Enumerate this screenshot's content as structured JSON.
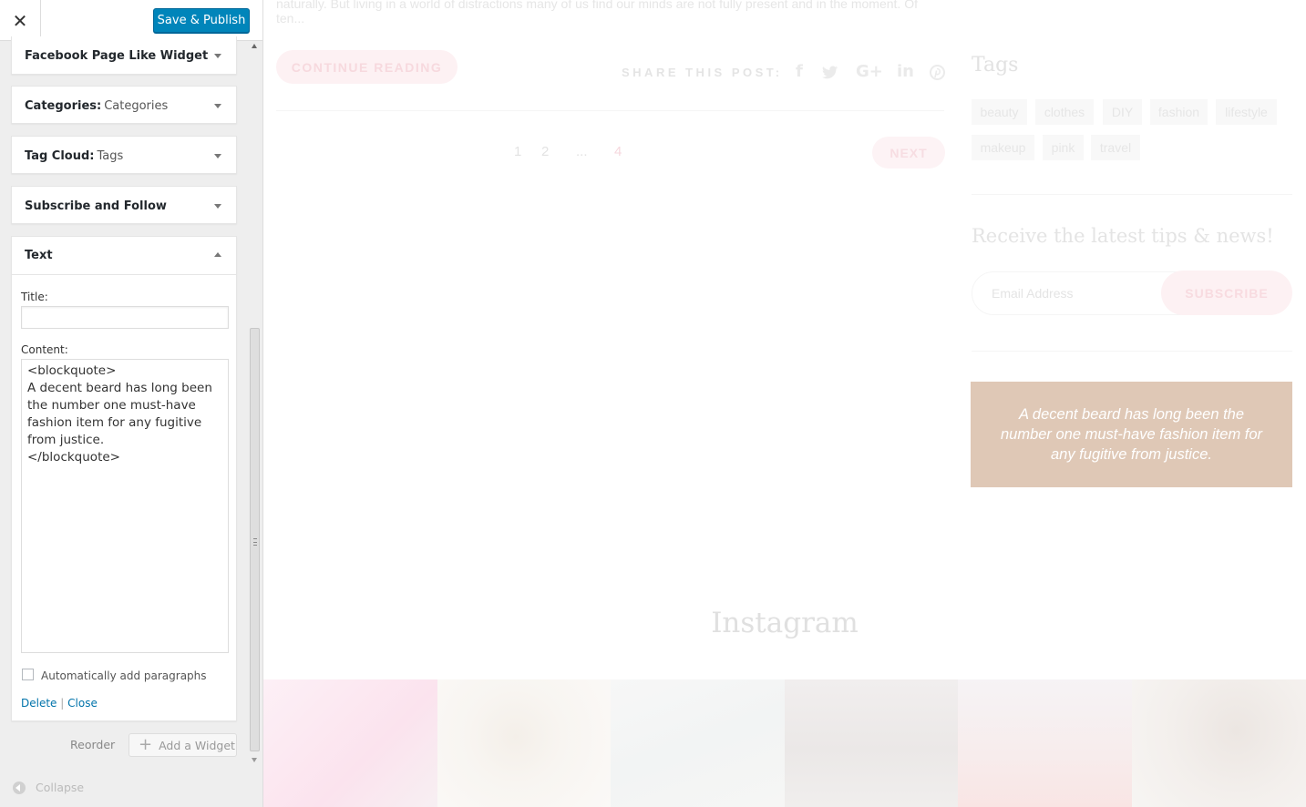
{
  "panel": {
    "close_glyph": "✕",
    "save_label": "Save & Publish",
    "widgets": [
      {
        "title": "Facebook Page Like Widget",
        "subtitle": ""
      },
      {
        "title": "Categories:",
        "subtitle": "Categories"
      },
      {
        "title": "Tag Cloud:",
        "subtitle": "Tags"
      },
      {
        "title": "Subscribe and Follow",
        "subtitle": ""
      }
    ],
    "text_widget": {
      "title": "Text",
      "title_label": "Title:",
      "title_value": "",
      "content_label": "Content:",
      "content_value": "<blockquote>\nA decent beard has long been the number one must-have fashion item for any fugitive from justice.\n</blockquote>",
      "autop_label": "Automatically add paragraphs",
      "autop_checked": false,
      "delete_label": "Delete",
      "separator": "|",
      "close_label": "Close"
    },
    "reorder_label": "Reorder",
    "add_widget_label": "Add a Widget",
    "collapse_label": "Collapse"
  },
  "preview": {
    "excerpt_line1": "naturally. But living in a world of distractions many of us find our minds are not fully present and in the moment. Of",
    "excerpt_line2": "ten...",
    "continue_label": "CONTINUE READING",
    "share_label": "SHARE THIS POST:",
    "share_icons": [
      "facebook-icon",
      "twitter-icon",
      "google-plus-icon",
      "linkedin-icon",
      "pinterest-icon"
    ],
    "pagination": [
      "1",
      "2",
      "...",
      "4"
    ],
    "next_label": "NEXT",
    "tags_title": "Tags",
    "tags": [
      "beauty",
      "clothes",
      "DIY",
      "fashion",
      "lifestyle",
      "makeup",
      "pink",
      "travel"
    ],
    "newsletter_title": "Receive the latest tips & news!",
    "email_placeholder": "Email Address",
    "subscribe_label": "SUBSCRIBE",
    "quote": "A decent beard has long been the number one must-have fashion item for any fugitive from justice.",
    "instagram_title": "Instagram"
  },
  "colors": {
    "primary_button": "#0085ba",
    "link": "#0073aa",
    "quote_bg": "#dfc8b6",
    "accent_pink": "#f8dbe0"
  }
}
